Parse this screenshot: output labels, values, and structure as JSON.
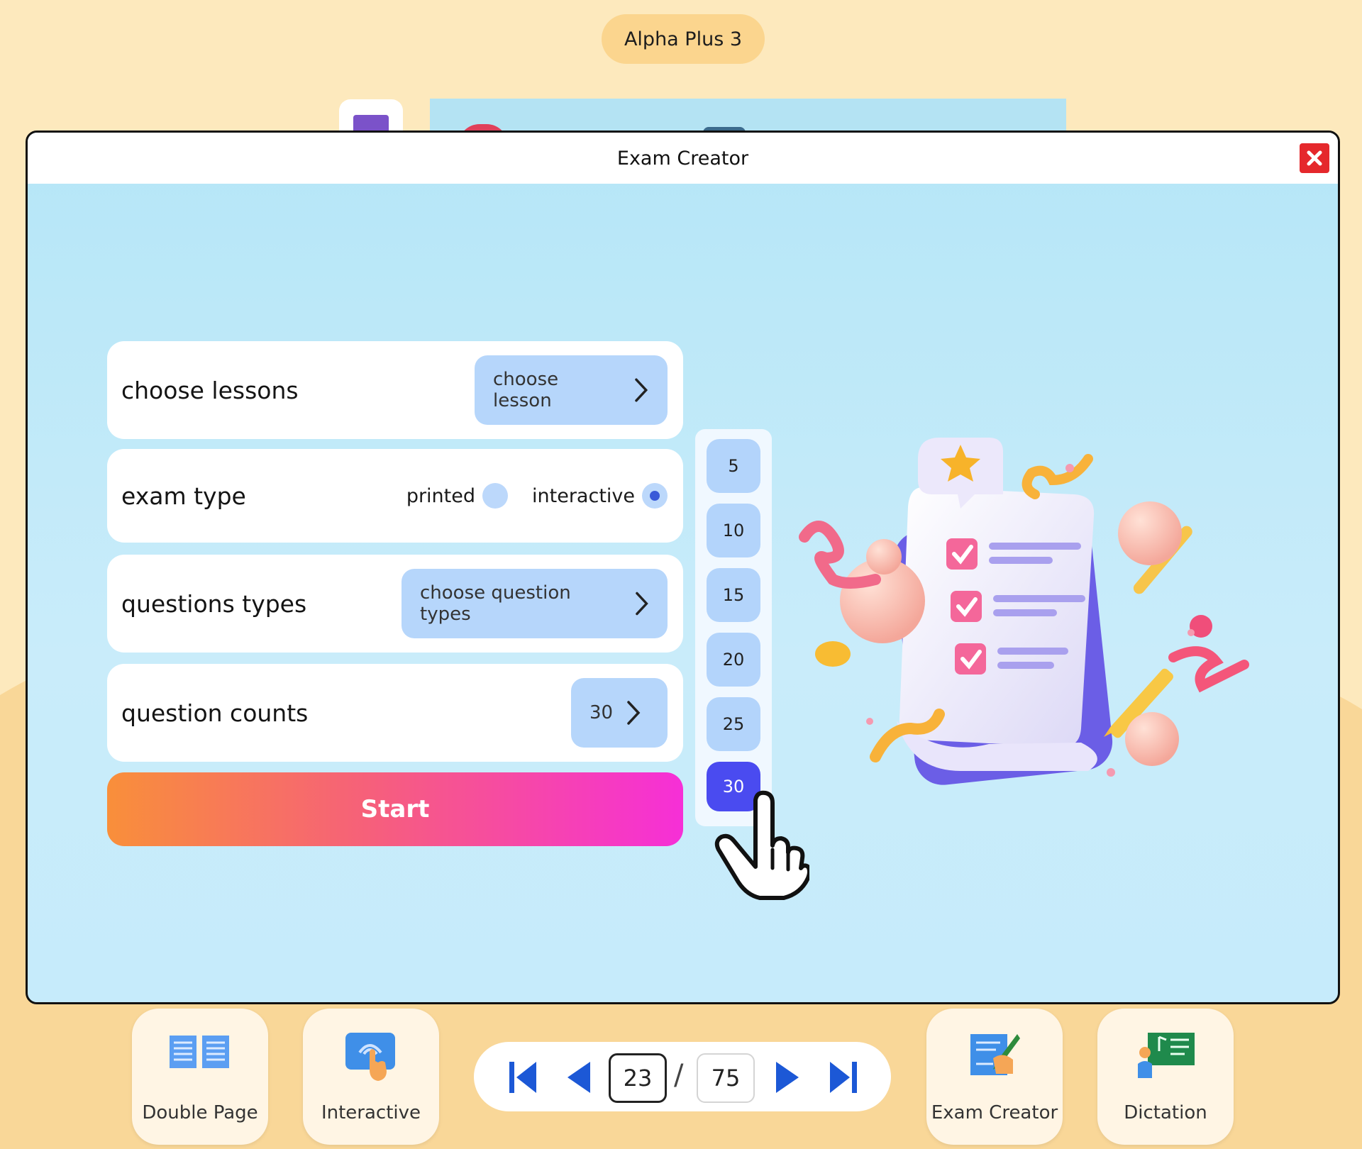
{
  "app": {
    "title": "Alpha Plus 3"
  },
  "modal": {
    "title": "Exam Creator",
    "close_icon": "close-icon"
  },
  "form": {
    "lessons": {
      "label": "choose lessons",
      "button": "choose lesson"
    },
    "exam_type": {
      "label": "exam type",
      "options": [
        {
          "label": "printed",
          "selected": false
        },
        {
          "label": "interactive",
          "selected": true
        }
      ]
    },
    "question_types": {
      "label": "questions types",
      "button": "choose question types"
    },
    "question_counts": {
      "label": "question counts",
      "value": "30"
    },
    "start_label": "Start"
  },
  "count_options": [
    "5",
    "10",
    "15",
    "20",
    "25",
    "30"
  ],
  "count_selected": "30",
  "toolbar": {
    "double_page": "Double Page",
    "interactive": "Interactive",
    "exam_creator": "Exam Creator",
    "dictation": "Dictation"
  },
  "pager": {
    "current": "23",
    "separator": "/",
    "total": "75"
  },
  "colors": {
    "accent_blue": "#4a4bf0",
    "pill_blue": "#b6d6fb",
    "close_red": "#e5282c",
    "start_gradient": [
      "#f98f3a",
      "#f6607a",
      "#f62fd7"
    ],
    "background": "#fde9bd"
  }
}
